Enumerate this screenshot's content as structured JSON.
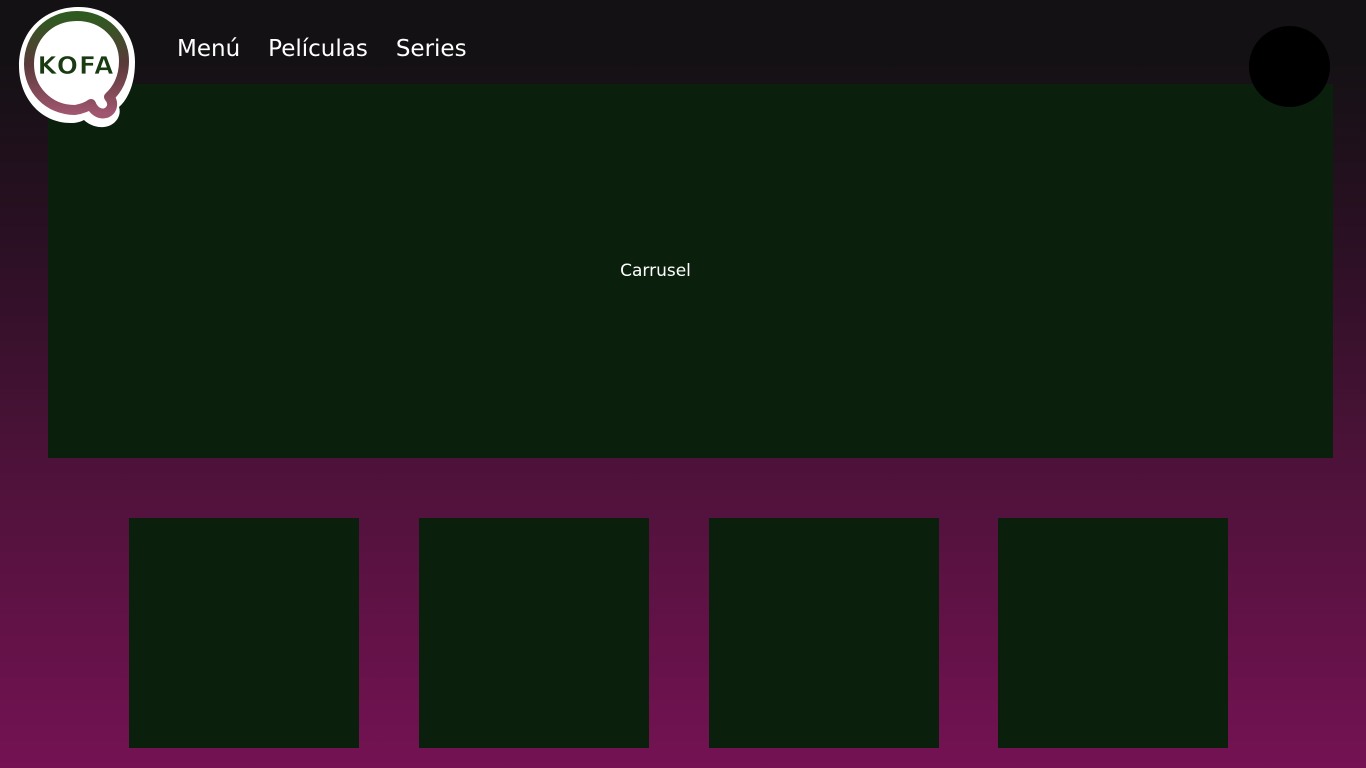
{
  "header": {
    "logo_text": "KOFA",
    "nav": {
      "items": [
        {
          "label": "Menú"
        },
        {
          "label": "Películas"
        },
        {
          "label": "Series"
        }
      ]
    },
    "avatar_icon": "user-avatar"
  },
  "carousel": {
    "label": "Carrusel"
  },
  "tiles": [
    {
      "name": "content-tile-1"
    },
    {
      "name": "content-tile-2"
    },
    {
      "name": "content-tile-3"
    },
    {
      "name": "content-tile-4"
    }
  ],
  "colors": {
    "background_top": "#141114",
    "background_bottom": "#741253",
    "panel": "#0a200d",
    "logo_green": "#2e5a1f",
    "logo_pink": "#a0566f"
  }
}
